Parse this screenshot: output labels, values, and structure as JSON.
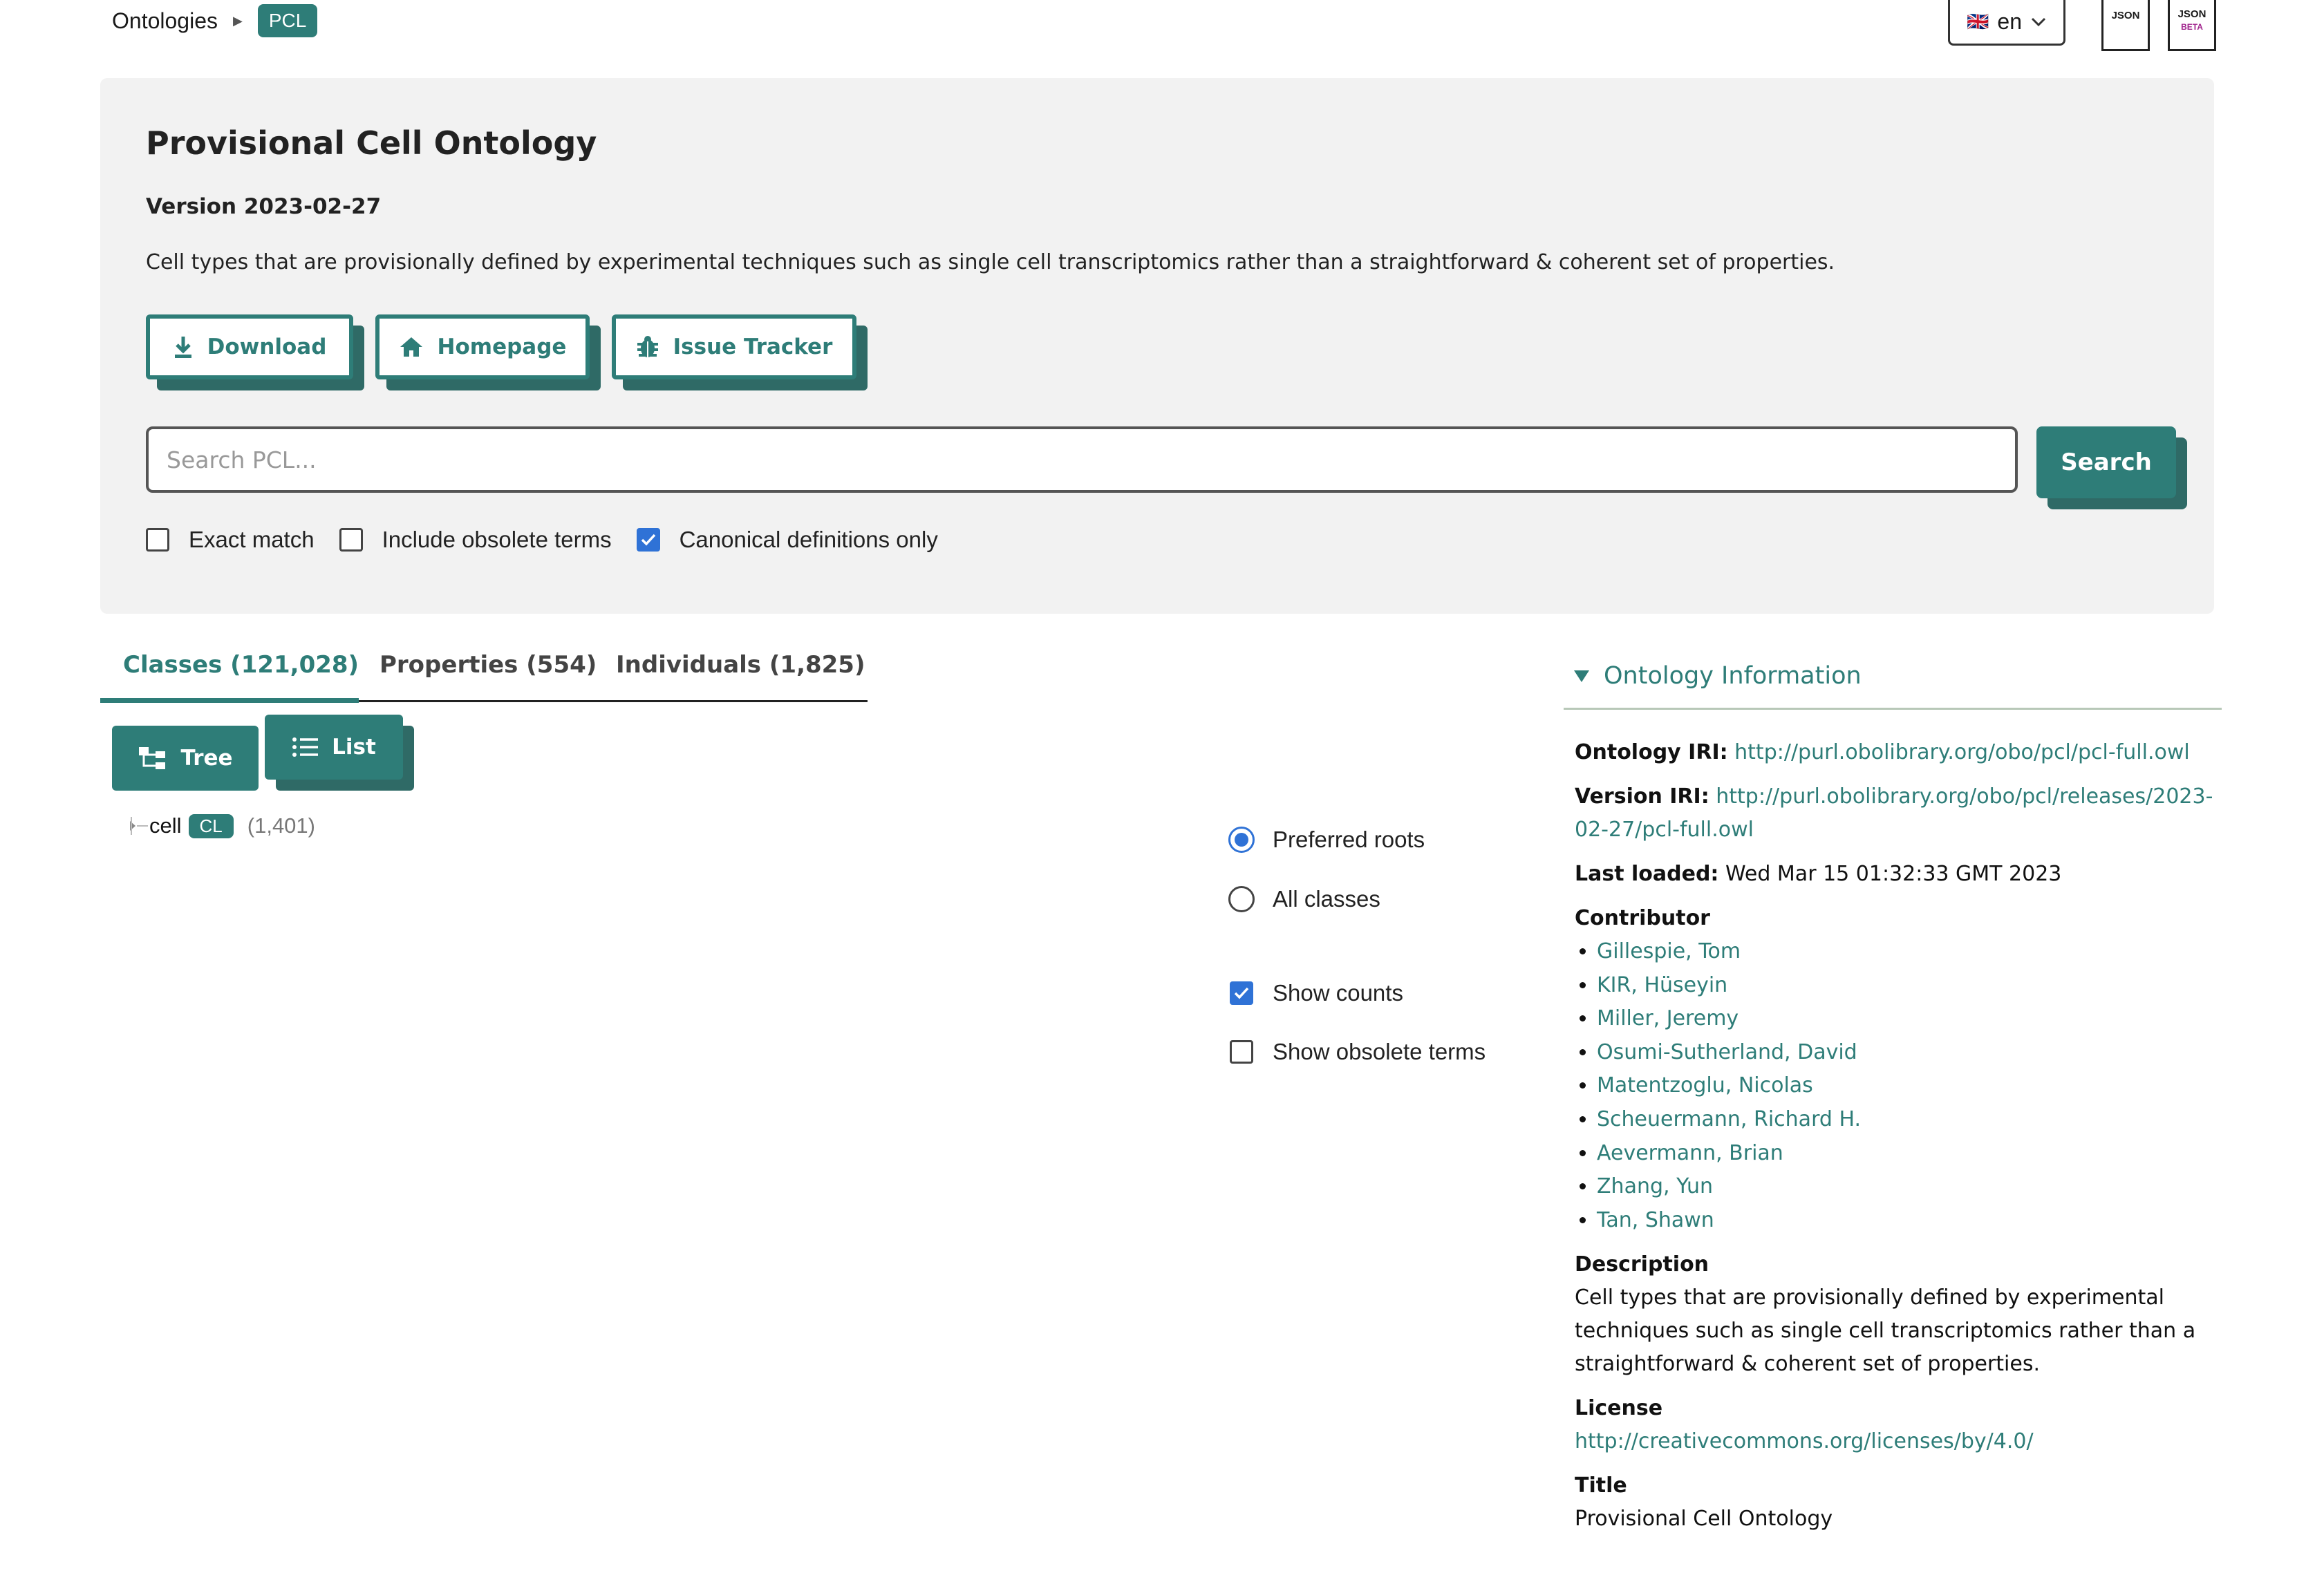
{
  "breadcrumb": {
    "root": "Ontologies",
    "current": "PCL"
  },
  "language": {
    "flag": "🇬🇧",
    "value": "en"
  },
  "json_buttons": [
    {
      "label": "JSON"
    },
    {
      "label": "JSON",
      "badge": "BETA"
    }
  ],
  "header": {
    "title": "Provisional Cell Ontology",
    "version": "Version 2023-02-27",
    "description": "Cell types that are provisionally defined by experimental techniques such as single cell transcriptomics rather than a straightforward & coherent set of properties.",
    "buttons": {
      "download": "Download",
      "homepage": "Homepage",
      "issue_tracker": "Issue Tracker"
    }
  },
  "search": {
    "placeholder": "Search PCL...",
    "button": "Search",
    "options": [
      {
        "label": "Exact match",
        "checked": false
      },
      {
        "label": "Include obsolete terms",
        "checked": false
      },
      {
        "label": "Canonical definitions only",
        "checked": true
      }
    ]
  },
  "tabs": [
    {
      "label": "Classes (121,028)",
      "active": true
    },
    {
      "label": "Properties (554)",
      "active": false
    },
    {
      "label": "Individuals (1,825)",
      "active": false
    }
  ],
  "view_buttons": {
    "tree": "Tree",
    "list": "List"
  },
  "tree": {
    "label": "cell",
    "badge": "CL",
    "count": "(1,401)"
  },
  "tree_options": {
    "roots": [
      {
        "label": "Preferred roots",
        "checked": true
      },
      {
        "label": "All classes",
        "checked": false
      }
    ],
    "toggles": [
      {
        "label": "Show counts",
        "checked": true
      },
      {
        "label": "Show obsolete terms",
        "checked": false
      }
    ]
  },
  "ontology_info": {
    "heading": "Ontology Information",
    "ontology_iri_label": "Ontology IRI:",
    "ontology_iri": "http://purl.obolibrary.org/obo/pcl/pcl-full.owl",
    "version_iri_label": "Version IRI:",
    "version_iri": "http://purl.obolibrary.org/obo/pcl/releases/2023-02-27/pcl-full.owl",
    "last_loaded_label": "Last loaded:",
    "last_loaded": "Wed Mar 15 01:32:33 GMT 2023",
    "contributor_label": "Contributor",
    "contributors": [
      "Gillespie, Tom",
      "KIR, Hüseyin",
      "Miller, Jeremy",
      "Osumi-Sutherland, David",
      "Matentzoglu, Nicolas",
      "Scheuermann, Richard H.",
      "Aevermann, Brian",
      "Zhang, Yun",
      "Tan, Shawn"
    ],
    "description_label": "Description",
    "description": "Cell types that are provisionally defined by experimental techniques such as single cell transcriptomics rather than a straightforward & coherent set of properties.",
    "license_label": "License",
    "license": "http://creativecommons.org/licenses/by/4.0/",
    "title_label": "Title",
    "title": "Provisional Cell Ontology"
  },
  "colors": {
    "accent": "#2e7d78",
    "checkbox": "#2f72d6",
    "panel": "#f2f2f2"
  }
}
